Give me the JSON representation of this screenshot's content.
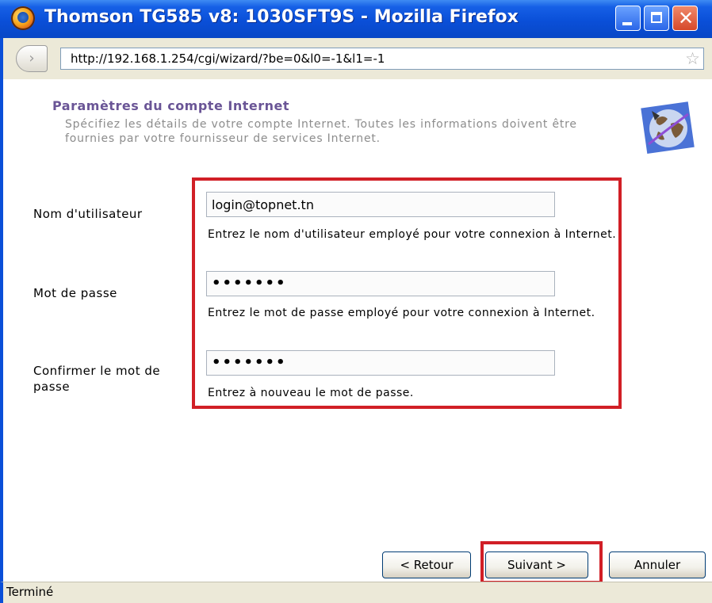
{
  "window": {
    "title": "Thomson TG585 v8:  1030SFT9S - Mozilla Firefox"
  },
  "browser": {
    "url": "http://192.168.1.254/cgi/wizard/?be=0&l0=-1&l1=-1",
    "status": "Terminé"
  },
  "page": {
    "heading": "Paramètres du compte Internet",
    "description": "Spécifiez les détails de votre compte Internet. Toutes les informations doivent être fournies par votre fournisseur de services Internet."
  },
  "form": {
    "username": {
      "label": "Nom d'utilisateur",
      "value": "login@topnet.tn",
      "hint": "Entrez le nom d'utilisateur employé pour votre connexion à Internet."
    },
    "password": {
      "label": "Mot de passe",
      "value": "•••••••",
      "hint": "Entrez le mot de passe employé pour votre connexion à Internet."
    },
    "confirm": {
      "label": "Confirmer le mot de passe",
      "value": "•••••••",
      "hint": "Entrez à nouveau le mot de passe."
    }
  },
  "buttons": {
    "back": "< Retour",
    "next": "Suivant >",
    "cancel": "Annuler"
  },
  "icons": {
    "app": "firefox-icon",
    "globe": "globe-icon",
    "bookmark": "star-icon"
  },
  "colors": {
    "titlebar": "#0a4fd8",
    "heading": "#6a5596",
    "highlight": "#d11f26"
  }
}
